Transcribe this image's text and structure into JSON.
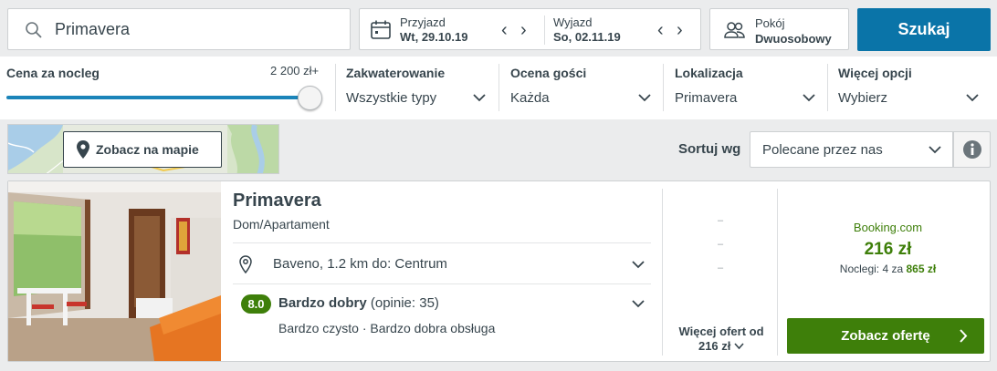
{
  "search": {
    "destination": "Primavera"
  },
  "dates": {
    "checkin_label": "Przyjazd",
    "checkin_value": "Wt, 29.10.19",
    "checkout_label": "Wyjazd",
    "checkout_value": "So, 02.11.19"
  },
  "room": {
    "label": "Pokój",
    "value": "Dwuosobowy"
  },
  "search_button": "Szukaj",
  "filters": {
    "price_title": "Cena za nocleg",
    "price_max": "2 200 zł+",
    "price_slider_fraction": 1.0,
    "accommodation_title": "Zakwaterowanie",
    "accommodation_value": "Wszystkie typy",
    "rating_title": "Ocena gości",
    "rating_value": "Każda",
    "location_title": "Lokalizacja",
    "location_value": "Primavera",
    "more_title": "Więcej opcji",
    "more_value": "Wybierz"
  },
  "map_button": "Zobacz na mapie",
  "sort": {
    "label": "Sortuj wg",
    "value": "Polecane przez nas"
  },
  "result": {
    "name": "Primavera",
    "type": "Dom/Apartament",
    "location": "Baveno, 1.2 km do: Centrum",
    "score": "8.0",
    "rating_word": "Bardzo dobry",
    "rating_reviews": "(opinie: 35)",
    "highlights": "Bardzo czysto · Bardzo dobra obsługa",
    "more_offers_line1": "Więcej ofert od",
    "more_offers_line2": "216 zł",
    "provider": "Booking.com",
    "price": "216 zł",
    "nights_text": "Noclegi: 4 za",
    "nights_total": "865 zł",
    "cta": "Zobacz ofertę"
  },
  "colors": {
    "primary_blue": "#0a74a8",
    "deal_green": "#3e7f0a",
    "text": "#37454d"
  }
}
